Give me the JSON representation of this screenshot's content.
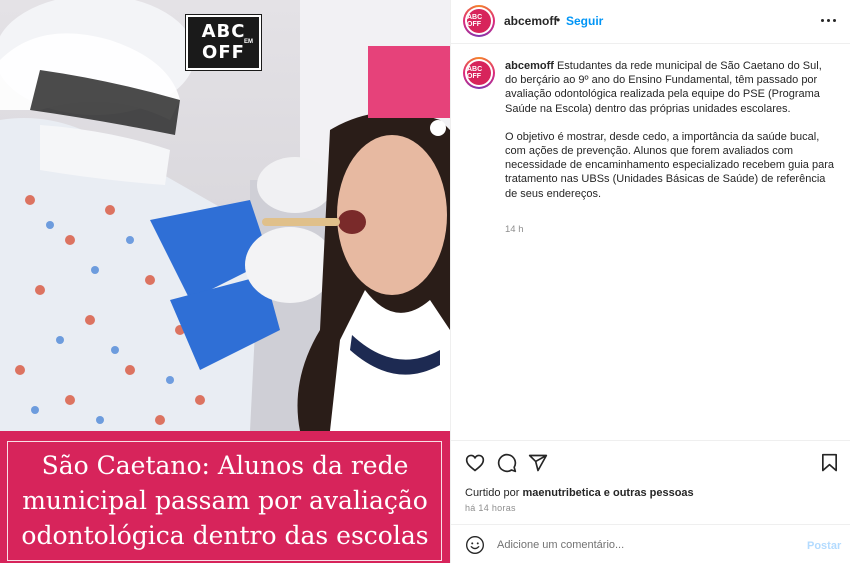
{
  "post": {
    "username": "abcemoff",
    "follow_label": "Seguir",
    "separator": "•",
    "avatar_text": "ABC OFF",
    "caption_paragraph_1": "Estudantes da rede municipal de São Caetano do Sul, do berçário ao 9º ano do Ensino Fundamental, têm passado por avaliação odontológica realizada pela equipe do PSE (Programa Saúde na Escola) dentro das próprias unidades escolares.",
    "caption_paragraph_2": "O objetivo é mostrar, desde cedo, a importância da saúde bucal, com ações de prevenção. Alunos que forem avaliados com necessidade de encaminhamento especializado recebem guia para tratamento nas UBSs (Unidades Básicas de Saúde) de referência de seus endereços.",
    "caption_time": "14 h"
  },
  "media": {
    "logo_top": "ABC",
    "logo_em": "EM",
    "logo_bottom": "OFF",
    "headline": "São Caetano: Alunos da rede municipal passam por avaliação odontológica dentro das escolas",
    "brand_color": "#d7245b"
  },
  "engagement": {
    "liked_prefix": "Curtido por",
    "liked_user": "maenutribetica",
    "liked_suffix": "e outras pessoas",
    "time_ago": "há 14 horas"
  },
  "comment_box": {
    "placeholder": "Adicione um comentário...",
    "post_label": "Postar"
  },
  "icons": [
    "more-options-icon",
    "heart-icon",
    "comment-icon",
    "share-icon",
    "bookmark-icon",
    "emoji-icon"
  ],
  "colors": {
    "link_blue": "#0095f6",
    "post_disabled": "#b3dbff",
    "caption_pink": "#d7245b"
  }
}
